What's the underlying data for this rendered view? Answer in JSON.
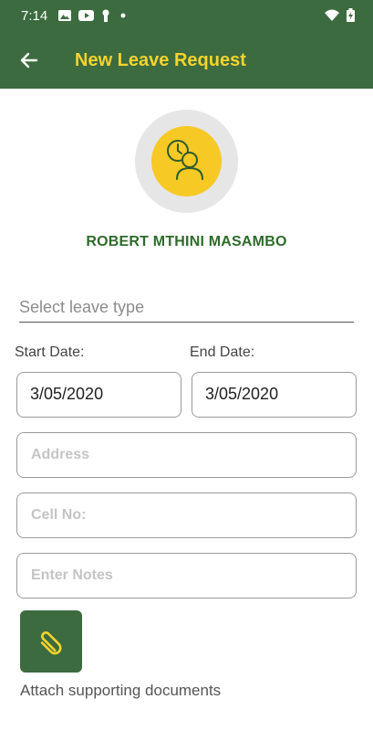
{
  "status_bar": {
    "time": "7:14",
    "icons_left": [
      "image-icon",
      "youtube-icon",
      "keyhole-icon",
      "dot-icon"
    ],
    "icons_right": [
      "wifi-icon",
      "battery-icon"
    ]
  },
  "app_bar": {
    "title": "New Leave Request",
    "back_icon": "arrow-left-icon"
  },
  "profile": {
    "name": "ROBERT MTHINI MASAMBO",
    "avatar_icon": "user-clock-icon"
  },
  "form": {
    "leave_type_placeholder": "Select leave type",
    "start_date_label": "Start Date:",
    "end_date_label": "End Date:",
    "start_date_value": "3/05/2020",
    "end_date_value": "3/05/2020",
    "address_placeholder": "Address",
    "cell_placeholder": "Cell No:",
    "notes_placeholder": "Enter Notes",
    "attach_label": "Attach supporting documents",
    "attach_icon": "paperclip-icon"
  },
  "colors": {
    "primary": "#3b6b3e",
    "accent": "#f6d32d",
    "name_text": "#2e6b2a"
  }
}
